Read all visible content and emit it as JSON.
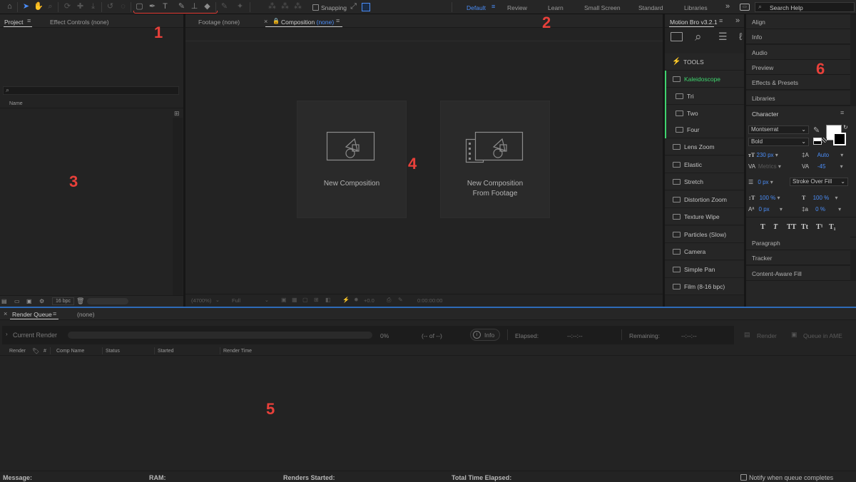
{
  "toolbar": {
    "snapping_label": "Snapping",
    "workspaces": [
      "Default",
      "Review",
      "Learn",
      "Small Screen",
      "Standard",
      "Libraries"
    ],
    "active_workspace": "Default",
    "search_placeholder": "Search Help"
  },
  "project_panel": {
    "tab_project": "Project",
    "tab_effect_controls": "Effect Controls (none)",
    "search_placeholder": "",
    "column_name": "Name",
    "bpc_label": "16 bpc"
  },
  "viewer": {
    "tab_footage": "Footage (none)",
    "tab_composition_prefix": "Composition",
    "tab_composition_value": "(none)",
    "cards": {
      "new_comp": "New Composition",
      "new_comp_footage_line1": "New Composition",
      "new_comp_footage_line2": "From Footage"
    },
    "bottom": {
      "zoom": "(4700%)",
      "resolution": "Full",
      "exposure": "+0.0",
      "timecode": "0:00:00:00"
    }
  },
  "motion_bro": {
    "tab": "Motion Bro v3.2.1",
    "tools_label": "TOOLS",
    "items": [
      {
        "label": "Kaleidoscope",
        "active": true,
        "sub": false
      },
      {
        "label": "Tri",
        "active": false,
        "sub": true
      },
      {
        "label": "Two",
        "active": false,
        "sub": true
      },
      {
        "label": "Four",
        "active": false,
        "sub": true
      },
      {
        "label": "Lens Zoom",
        "active": false,
        "sub": false
      },
      {
        "label": "Elastic",
        "active": false,
        "sub": false
      },
      {
        "label": "Stretch",
        "active": false,
        "sub": false
      },
      {
        "label": "Distortion Zoom",
        "active": false,
        "sub": false
      },
      {
        "label": "Texture Wipe",
        "active": false,
        "sub": false
      },
      {
        "label": "Particles (Slow)",
        "active": false,
        "sub": false
      },
      {
        "label": "Camera",
        "active": false,
        "sub": false
      },
      {
        "label": "Simple Pan",
        "active": false,
        "sub": false
      },
      {
        "label": "Film (8-16 bpc)",
        "active": false,
        "sub": false
      }
    ],
    "accent": "#3fd46e"
  },
  "right_panels": {
    "top": [
      "Align",
      "Info",
      "Audio",
      "Preview",
      "Effects & Presets",
      "Libraries"
    ],
    "character_title": "Character",
    "bottom": [
      "Paragraph",
      "Tracker",
      "Content-Aware Fill"
    ]
  },
  "character": {
    "font_family": "Montserrat",
    "font_style": "Bold",
    "font_size": "230 px",
    "leading": "Auto",
    "kerning": "Metrics",
    "tracking": "-45",
    "stroke_width": "0 px",
    "stroke_mode": "Stroke Over Fill",
    "vscale": "100 %",
    "hscale": "100 %",
    "baseline": "0 px",
    "tsume": "0 %",
    "type_buttons": [
      "T",
      "T",
      "TT",
      "Tt",
      "T¹",
      "T₁"
    ]
  },
  "render_queue": {
    "tab": "Render Queue",
    "tab_none": "(none)",
    "current_render": "Current Render",
    "progress_percent": "0%",
    "progress_value": 0,
    "of_label": "(-- of --)",
    "info_label": "Info",
    "elapsed_label": "Elapsed:",
    "elapsed_value": "--:--:--",
    "remaining_label": "Remaining:",
    "remaining_value": "--:--:--",
    "render_button": "Render",
    "queue_ame_button": "Queue in AME",
    "columns": [
      "Render",
      "#",
      "Comp Name",
      "Status",
      "Started",
      "Render Time"
    ]
  },
  "status_bar": {
    "message": "Message:",
    "ram": "RAM:",
    "renders_started": "Renders Started:",
    "total_time_elapsed": "Total Time Elapsed:",
    "notify": "Notify when queue completes"
  },
  "annotations": [
    "1",
    "2",
    "3",
    "4",
    "5",
    "6"
  ],
  "colors": {
    "accent_blue": "#4a8df8",
    "annotation_red": "#e8403a",
    "kaleidoscope_green": "#3fd46e"
  }
}
